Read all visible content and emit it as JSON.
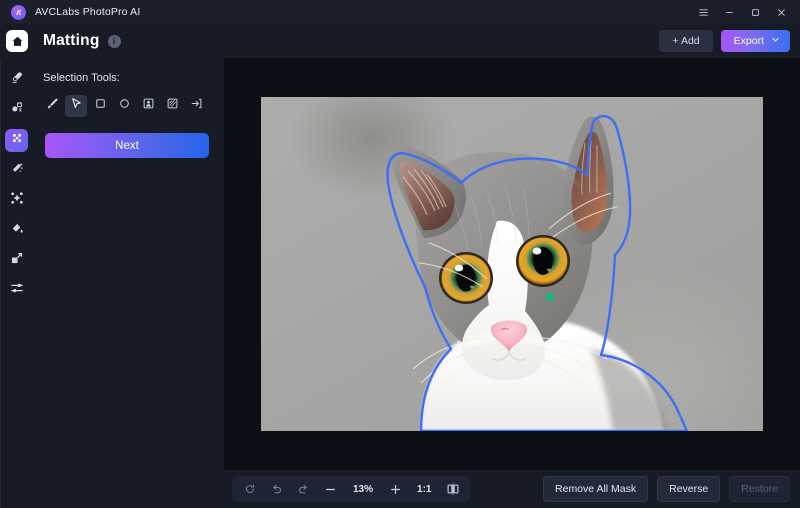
{
  "titlebar": {
    "app_name": "AVCLabs PhotoPro AI",
    "logo_icon": "avclabs-logo-icon",
    "menu_icon": "hamburger-menu-icon",
    "minimize_icon": "minimize-icon",
    "maximize_icon": "maximize-icon",
    "close_icon": "close-icon"
  },
  "header": {
    "home_icon": "home-icon",
    "title": "Matting",
    "info_icon": "info-icon",
    "add_label": "+ Add",
    "export_label": "Export",
    "export_chevron_icon": "chevron-down-icon"
  },
  "rail": {
    "items": [
      {
        "name": "eraser-tool",
        "icon": "eraser-icon",
        "active": false
      },
      {
        "name": "object-remove-tool",
        "icon": "object-remove-icon",
        "active": false
      },
      {
        "name": "matting-tool",
        "icon": "matting-icon",
        "active": true
      },
      {
        "name": "magic-wand-tool",
        "icon": "magic-wand-icon",
        "active": false
      },
      {
        "name": "enhance-tool",
        "icon": "sparkle-enhance-icon",
        "active": false
      },
      {
        "name": "color-fill-tool",
        "icon": "paint-bucket-icon",
        "active": false
      },
      {
        "name": "resize-tool",
        "icon": "resize-expand-icon",
        "active": false
      },
      {
        "name": "adjust-tool",
        "icon": "sliders-adjust-icon",
        "active": false
      }
    ]
  },
  "tools_panel": {
    "label": "Selection Tools:",
    "tools": [
      {
        "name": "brush-tool",
        "icon": "brush-icon",
        "active": false
      },
      {
        "name": "pointer-tool",
        "icon": "cursor-arrow-icon",
        "active": true
      },
      {
        "name": "rectangle-select-tool",
        "icon": "square-icon",
        "active": false
      },
      {
        "name": "ellipse-select-tool",
        "icon": "circle-icon",
        "active": false
      },
      {
        "name": "portrait-select-tool",
        "icon": "portrait-person-icon",
        "active": false
      },
      {
        "name": "texture-select-tool",
        "icon": "hatched-square-icon",
        "active": false
      },
      {
        "name": "import-select-tool",
        "icon": "arrow-into-box-icon",
        "active": false
      }
    ],
    "next_label": "Next"
  },
  "canvas": {
    "image_alt": "cat-portrait",
    "selection_outline_color": "#3d6ef5",
    "selection_point_color": "#16b87d",
    "background_color": "#0b0e15"
  },
  "bottombar": {
    "reset_icon": "reset-rotate-icon",
    "undo_icon": "undo-icon",
    "redo_icon": "redo-icon",
    "zoom_out_icon": "minus-icon",
    "zoom_level": "13%",
    "zoom_in_icon": "plus-icon",
    "actual_size_label": "1:1",
    "compare_icon": "split-compare-icon",
    "remove_all_mask_label": "Remove All Mask",
    "reverse_label": "Reverse",
    "restore_label": "Restore",
    "restore_disabled": true
  },
  "colors": {
    "app_bg": "#161b26",
    "titlebar_bg": "#1a1f2b",
    "canvas_bg": "#0b0e15",
    "accent_purple": "#8b5cf6",
    "accent_blue": "#2563eb",
    "selection_blue": "#3d6ef5"
  }
}
